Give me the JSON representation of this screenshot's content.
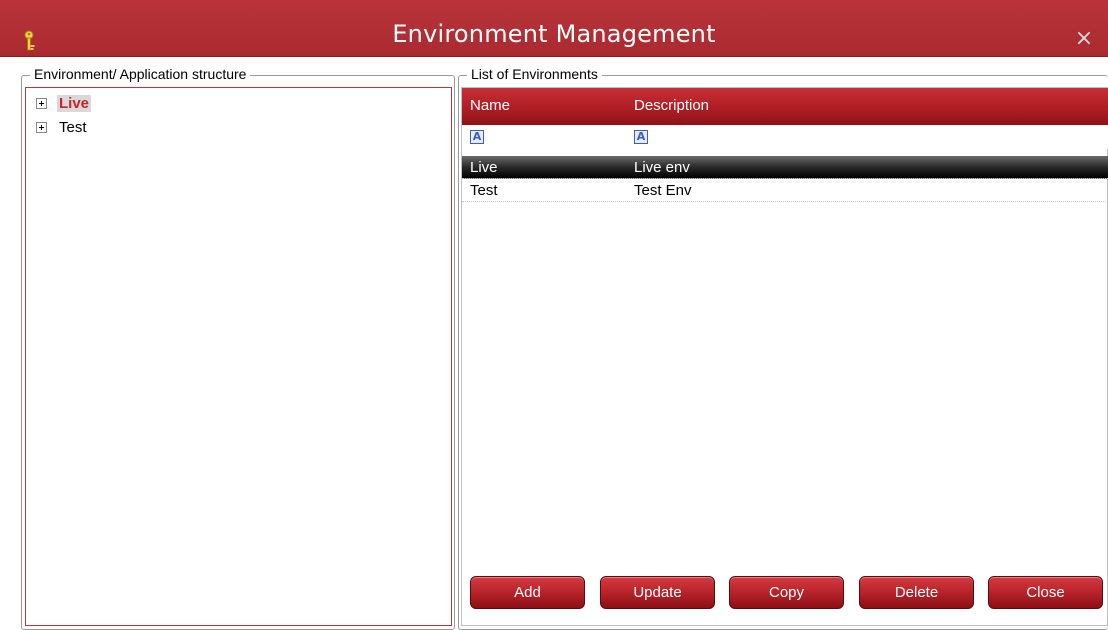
{
  "window": {
    "title": "Environment Management",
    "close_glyph": "×",
    "app_icon": "key-icon",
    "accent_color": "#b03036"
  },
  "left_panel": {
    "legend": "Environment/ Application structure",
    "tree": [
      {
        "label": "Live",
        "selected": true
      },
      {
        "label": "Test",
        "selected": false
      }
    ]
  },
  "right_panel": {
    "legend": "List of Environments",
    "columns": [
      "Name",
      "Description"
    ],
    "filter_icon": "A",
    "rows": [
      {
        "name": "Live",
        "description": "Live env",
        "selected": true
      },
      {
        "name": "Test",
        "description": "Test Env",
        "selected": false
      }
    ]
  },
  "buttons": {
    "add": "Add",
    "update": "Update",
    "copy": "Copy",
    "delete": "Delete",
    "close": "Close"
  }
}
